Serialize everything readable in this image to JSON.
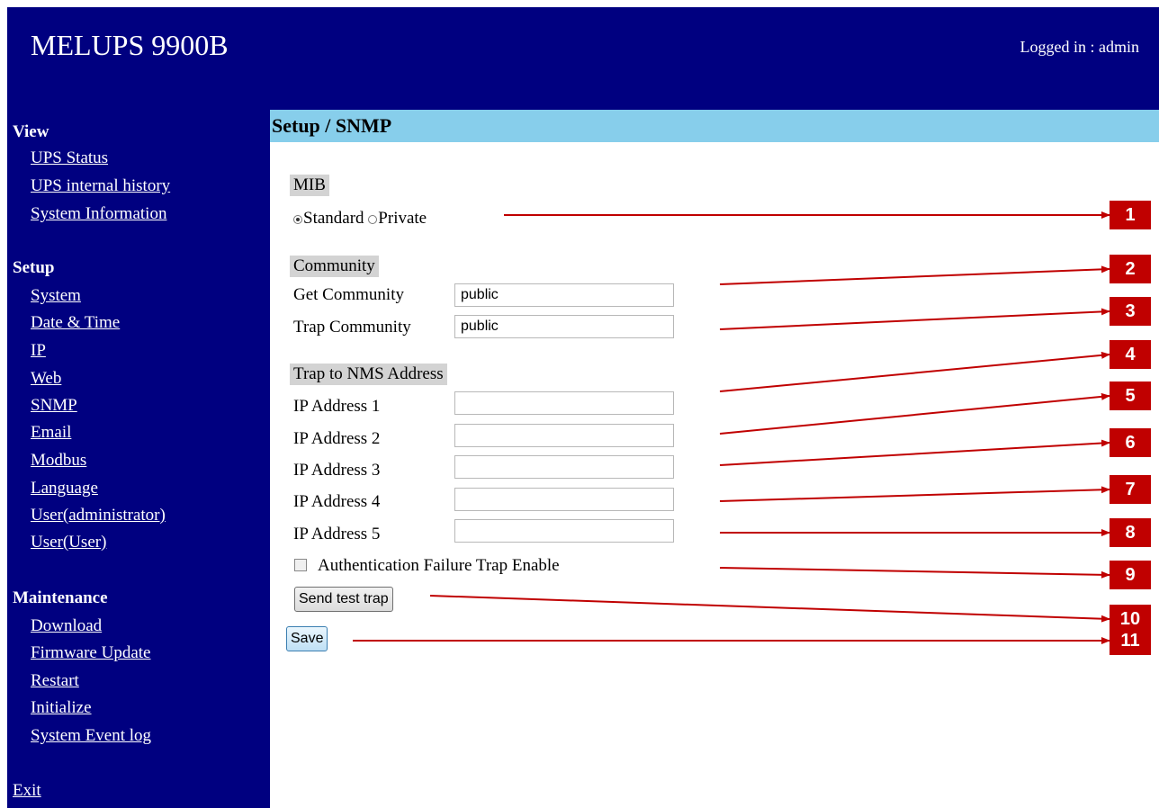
{
  "header": {
    "title": "MELUPS 9900B",
    "login_status": "Logged in : admin"
  },
  "sidebar": {
    "view": {
      "title": "View",
      "items": [
        "UPS Status",
        "UPS internal history",
        "System Information"
      ]
    },
    "setup": {
      "title": "Setup",
      "items": [
        "System",
        "Date & Time",
        "IP",
        "Web",
        "SNMP",
        "Email",
        "Modbus",
        "Language",
        "User(administrator)",
        "User(User)"
      ]
    },
    "maintenance": {
      "title": "Maintenance",
      "items": [
        "Download",
        "Firmware Update",
        "Restart",
        "Initialize",
        "System Event log"
      ]
    },
    "exit": "Exit"
  },
  "main": {
    "title": "Setup / SNMP",
    "mib": {
      "label": "MIB",
      "options": [
        "Standard",
        "Private"
      ],
      "selected": "Standard"
    },
    "community": {
      "label": "Community",
      "get_label": "Get Community",
      "get_value": "public",
      "trap_label": "Trap Community",
      "trap_value": "public"
    },
    "trap_nms": {
      "label": "Trap to NMS Address",
      "addresses": [
        {
          "label": "IP Address 1",
          "value": ""
        },
        {
          "label": "IP Address 2",
          "value": ""
        },
        {
          "label": "IP Address 3",
          "value": ""
        },
        {
          "label": "IP Address 4",
          "value": ""
        },
        {
          "label": "IP Address 5",
          "value": ""
        }
      ]
    },
    "auth_failure": {
      "label": "Authentication Failure Trap Enable",
      "checked": false
    },
    "send_test_label": "Send test trap",
    "save_label": "Save"
  },
  "callouts": [
    "1",
    "2",
    "3",
    "4",
    "5",
    "6",
    "7",
    "8",
    "9",
    "10",
    "11"
  ],
  "colors": {
    "header_bg": "#000080",
    "title_bar_bg": "#87ceeb",
    "callout": "#c00000",
    "group_label_bg": "#d3d3d3"
  }
}
